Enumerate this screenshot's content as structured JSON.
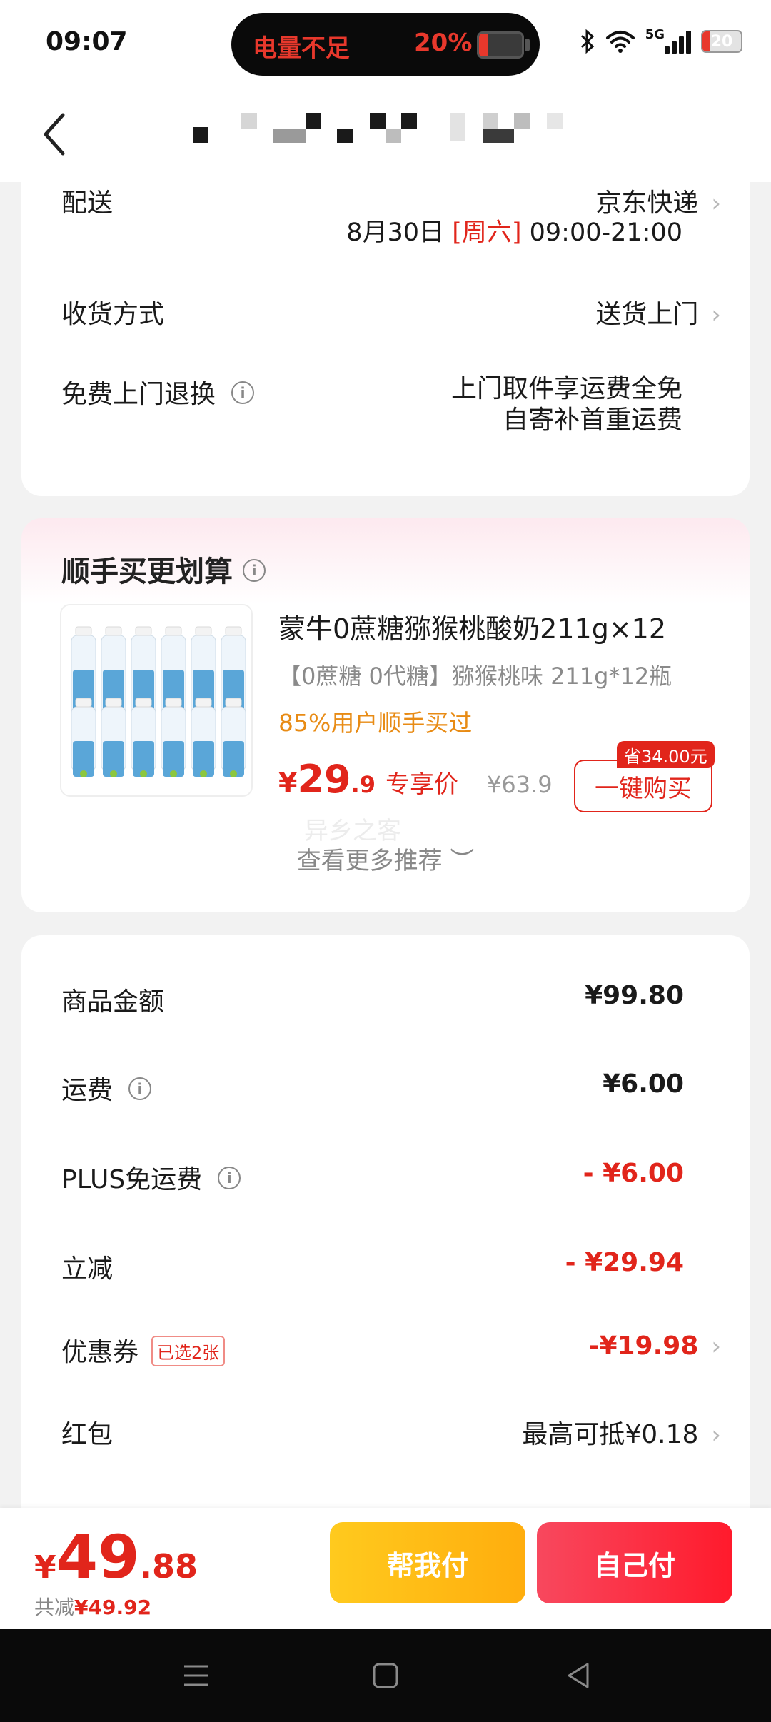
{
  "status_bar": {
    "time": "09:07",
    "battery_warning": "电量不足",
    "battery_percent": "20%",
    "battery_level": 20,
    "network": "5G",
    "battery_icon_text": "20"
  },
  "delivery": {
    "label": "配送",
    "carrier": "京东快递",
    "date": "8月30日",
    "weekday": "[周六]",
    "time_slot": "09:00-21:00",
    "receive_label": "收货方式",
    "receive_value": "送货上门",
    "return_label": "免费上门退换",
    "return_line1": "上门取件享运费全免",
    "return_line2": "自寄补首重运费"
  },
  "recommend": {
    "title": "顺手买更划算",
    "product_name": "蒙牛0蔗糖猕猴桃酸奶211g×12",
    "product_sub": "【0蔗糖 0代糖】猕猴桃味 211g*12瓶",
    "social_proof": "85%用户顺手买过",
    "price_yen": "¥",
    "price_int": "29",
    "price_dec": ".9",
    "price_tag": "专享价",
    "original_price": "¥63.9",
    "buy_button": "一键购买",
    "save_badge": "省34.00元",
    "watermark": "异乡之客",
    "more_label": "查看更多推荐 ︶"
  },
  "summary": {
    "goods_label": "商品金额",
    "goods_value": "¥99.80",
    "shipping_label": "运费",
    "shipping_value": "¥6.00",
    "plus_label": "PLUS免运费",
    "plus_value": "- ¥6.00",
    "discount_label": "立减",
    "discount_value": "- ¥29.94",
    "coupon_label": "优惠券",
    "coupon_tag": "已选2张",
    "coupon_value": "-¥19.98",
    "redpacket_label": "红包",
    "redpacket_value": "最高可抵¥0.18"
  },
  "bottom": {
    "yen": "¥",
    "total_int": "49",
    "total_dec": ".88",
    "saved_prefix": "共减",
    "saved_value": "¥49.92",
    "help_pay": "帮我付",
    "self_pay": "自己付"
  },
  "icons": {
    "back": "chevron-left-icon",
    "info": "info-icon",
    "chevron": "chevron-right-icon"
  },
  "colors": {
    "accent_red": "#e1251b",
    "accent_orange": "#e88b14",
    "help_button": "#ffb812",
    "self_button": "#fc2e40"
  }
}
